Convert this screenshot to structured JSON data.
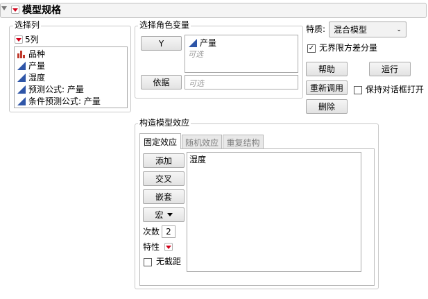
{
  "header": {
    "title": "模型规格"
  },
  "select_columns": {
    "legend": "选择列",
    "count_label": "5列",
    "columns": [
      {
        "label": "品种",
        "icon": "nominal-bar-icon"
      },
      {
        "label": "产量",
        "icon": "continuous-triangle-icon"
      },
      {
        "label": "湿度",
        "icon": "continuous-triangle-icon"
      },
      {
        "label": "预测公式: 产量",
        "icon": "continuous-triangle-icon"
      },
      {
        "label": "条件预测公式: 产量",
        "icon": "continuous-triangle-icon"
      }
    ]
  },
  "roles": {
    "legend": "选择角色变量",
    "y_button": "Y",
    "y_value": "产量",
    "optional": "可选",
    "by_button": "依据",
    "by_placeholder": "可选"
  },
  "personality": {
    "label": "特质:",
    "selected": "混合模型",
    "unbounded_checkbox": "无界限方差分量",
    "unbounded_checked": true
  },
  "actions": {
    "help": "帮助",
    "run": "运行",
    "recall": "重新调用",
    "keep_dialog": "保持对话框打开",
    "keep_dialog_checked": false,
    "remove": "删除"
  },
  "effects": {
    "legend": "构造模型效应",
    "tabs": [
      "固定效应",
      "随机效应",
      "重复结构"
    ],
    "active_tab": 0,
    "add": "添加",
    "cross": "交叉",
    "nest": "嵌套",
    "macros": "宏",
    "degree_label": "次数",
    "degree_value": "2",
    "attributes_label": "特性",
    "no_intercept": "无截距",
    "no_intercept_checked": false,
    "effect_list": [
      "湿度"
    ]
  },
  "colors": {
    "accent_red": "#d0021b",
    "continuous_blue": "#2f56a8",
    "nominal_red": "#c0392b"
  }
}
